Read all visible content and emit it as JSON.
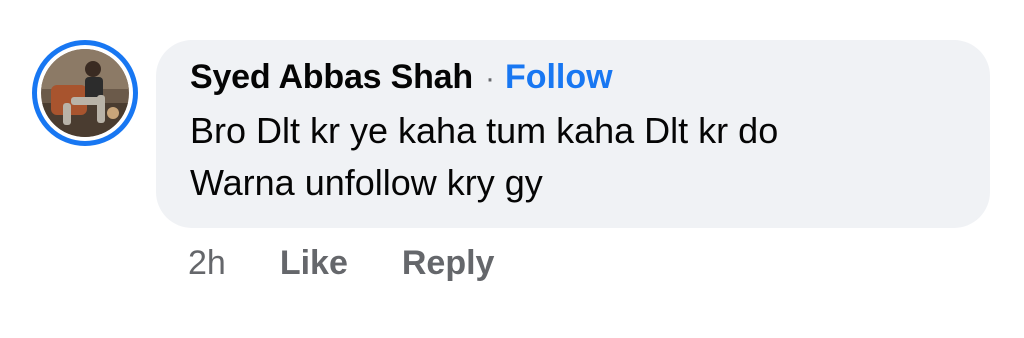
{
  "comment": {
    "author": "Syed Abbas Shah",
    "separator": "·",
    "follow_label": "Follow",
    "text": "Bro Dlt kr ye kaha tum kaha Dlt kr do\nWarna unfollow kry gy",
    "timestamp": "2h",
    "like_label": "Like",
    "reply_label": "Reply"
  },
  "colors": {
    "accent": "#1877f2",
    "bubble_bg": "#f0f2f5",
    "muted_text": "#65676b",
    "text": "#050505"
  },
  "icons": {
    "avatar": "profile-photo-avatar"
  }
}
